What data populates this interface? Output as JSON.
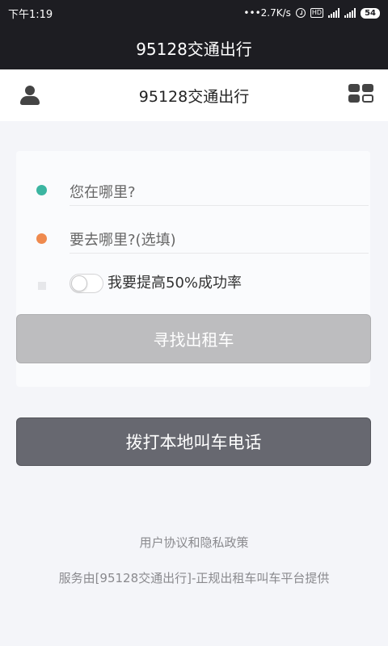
{
  "status_bar": {
    "time": "下午1:19",
    "network_speed": "•••2.7K/s",
    "icons": [
      "alarm-icon",
      "hd-icon",
      "signal-4g-icon",
      "signal-icon"
    ],
    "hd_label": "HD",
    "battery": "54"
  },
  "app_bar": {
    "title": "95128交通出行"
  },
  "header": {
    "title": "95128交通出行",
    "left_icon": "user-icon",
    "right_icon": "grid-icon"
  },
  "form": {
    "origin_placeholder": "您在哪里?",
    "destination_placeholder": "要去哪里?(选填)",
    "boost_label": "我要提高50%成功率",
    "boost_enabled": false,
    "find_button": "寻找出租车"
  },
  "call_button": "拨打本地叫车电话",
  "footer": {
    "policy_link": "用户协议和隐私政策",
    "service_note": "服务由[95128交通出行]-正规出租车叫车平台提供"
  },
  "colors": {
    "dark_bar": "#1d1d22",
    "origin_dot": "#3bb5a1",
    "destination_dot": "#ef8a4e",
    "find_button_bg": "#bdbdbf",
    "call_button_bg": "#676870"
  }
}
